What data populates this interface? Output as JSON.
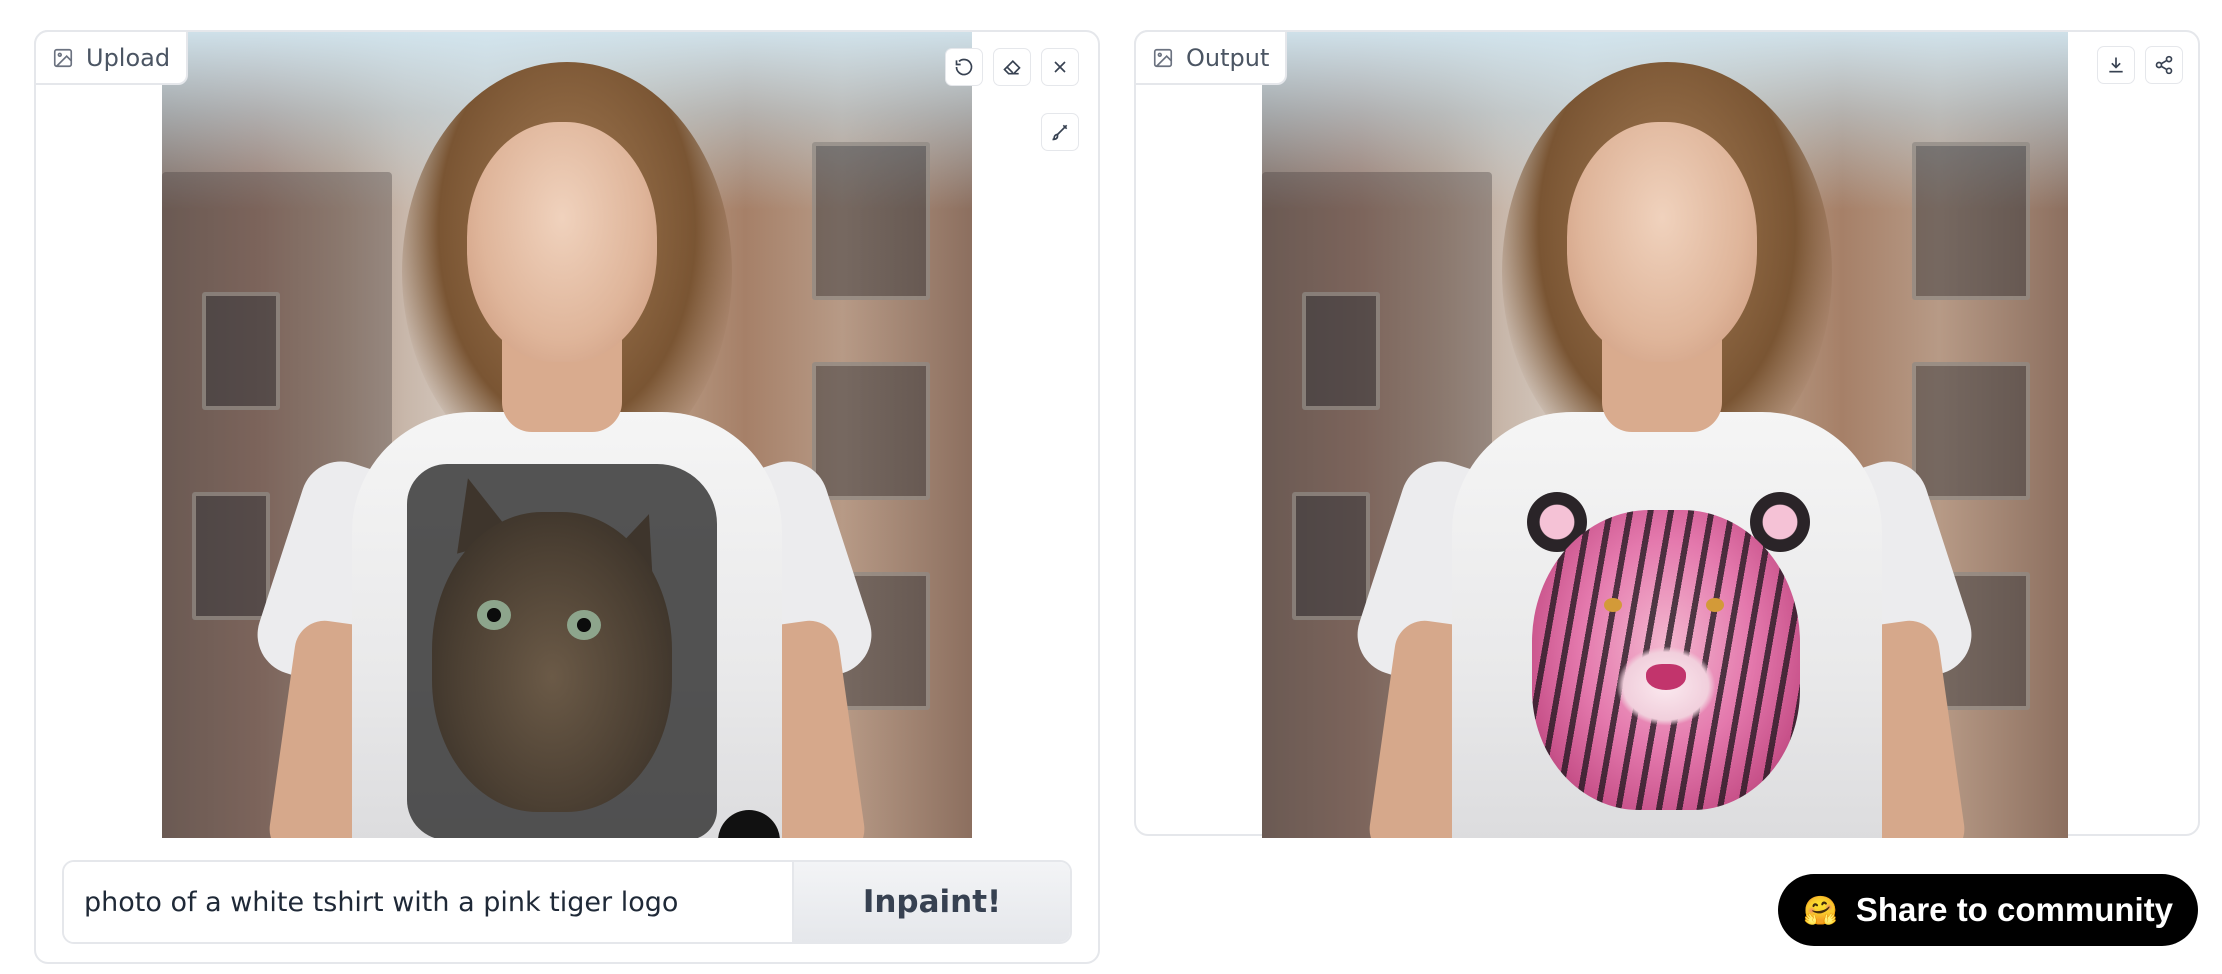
{
  "upload_panel": {
    "label": "Upload",
    "icons": [
      "image-icon",
      "undo-icon",
      "eraser-icon",
      "close-icon",
      "brush-icon"
    ]
  },
  "output_panel": {
    "label": "Output",
    "icons": [
      "image-icon",
      "download-icon",
      "share-icon"
    ]
  },
  "prompt": {
    "value": "photo of a white tshirt with a pink tiger logo"
  },
  "inpaint_button": {
    "label": "Inpaint!"
  },
  "share_button": {
    "emoji": "🤗",
    "label": "Share to community"
  }
}
